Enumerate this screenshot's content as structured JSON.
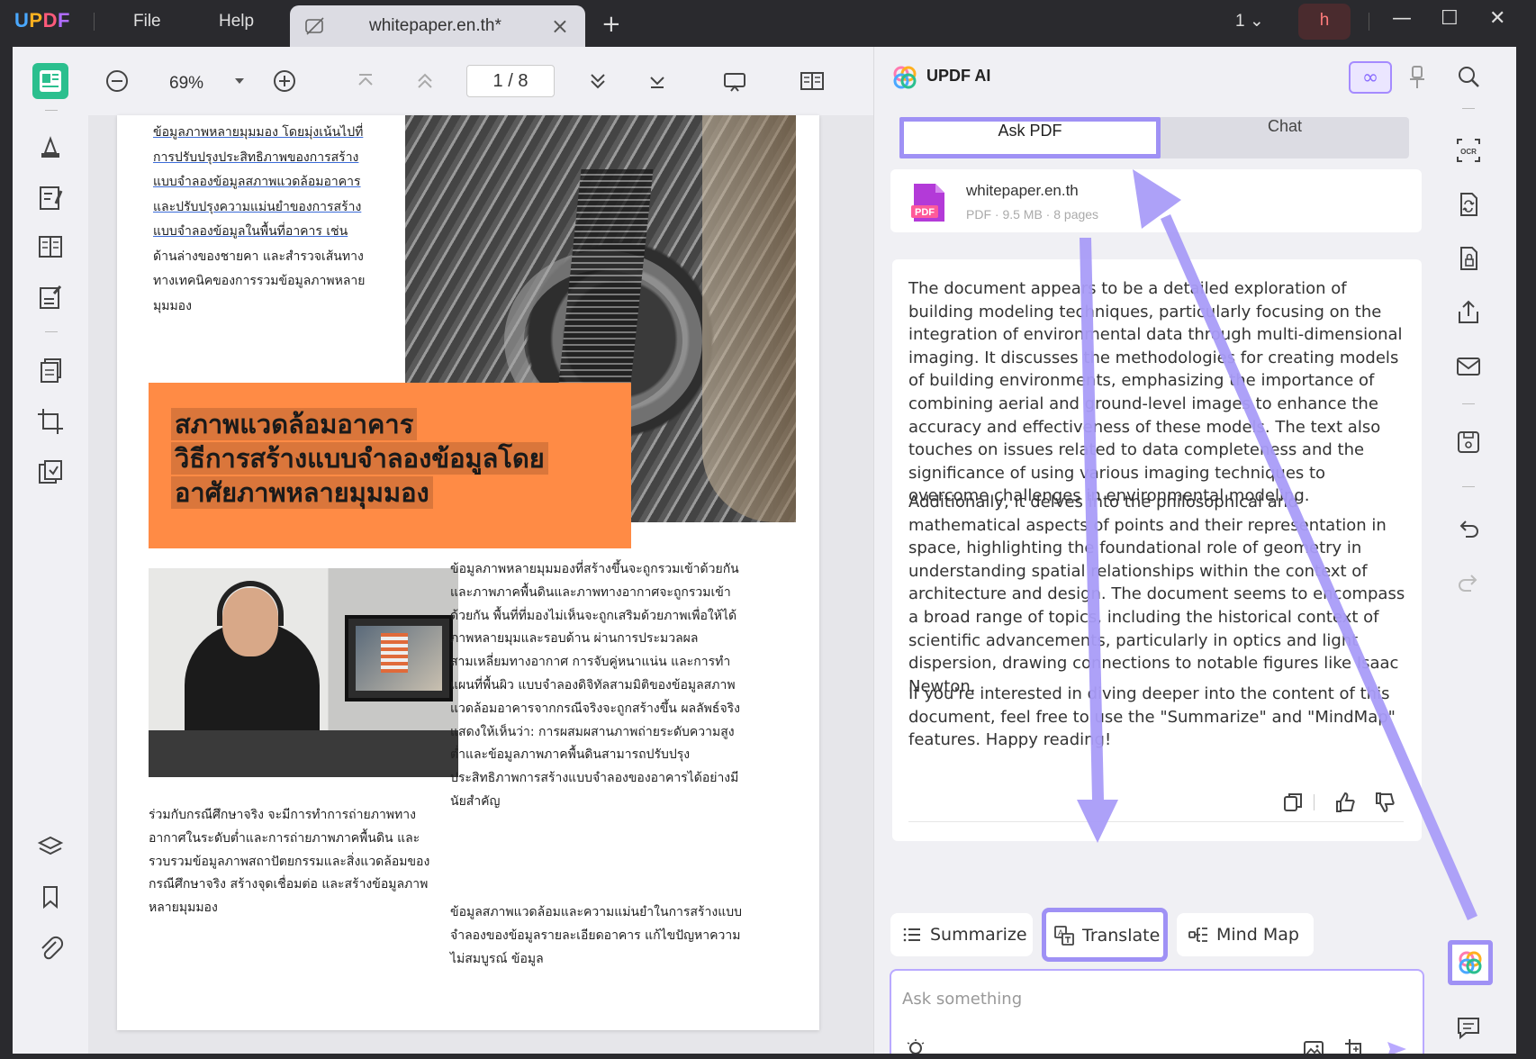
{
  "titlebar": {
    "logo": {
      "u": "U",
      "p": "P",
      "d": "D",
      "f": "F"
    },
    "menu_file": "File",
    "menu_help": "Help",
    "tab_title": "whitepaper.en.th*",
    "tab_close": "×",
    "new_tab": "+",
    "page_count": "1",
    "avatar_letter": "h",
    "minimize": "—",
    "maximize": "☐",
    "close": "✕"
  },
  "toolbar": {
    "zoom": "69%",
    "page_current": "1",
    "page_sep": "/",
    "page_total": "8"
  },
  "document": {
    "p1": [
      "ข้อมูลภาพหลายมุมมอง โดยมุ่งเน้นไปที่",
      "การปรับปรุงประสิทธิภาพของการสร้าง",
      "แบบจำลองข้อมูลสภาพแวดล้อมอาคาร",
      "และปรับปรุงความแม่นยำของการสร้าง",
      "แบบจำลองข้อมูลในพื้นที่อาคาร เช่น",
      "ด้านล่างของชายคา และสำรวจเส้นทาง",
      "ทางเทคนิคของการรวมข้อมูลภาพหลาย",
      "มุมมอง"
    ],
    "heading": [
      "สภาพแวดล้อมอาคาร",
      "วิธีการสร้างแบบจำลองข้อมูลโดย",
      "อาศัยภาพหลายมุมมอง"
    ],
    "p2": "ข้อมูลภาพหลายมุมมองที่สร้างขึ้นจะถูกรวมเข้าด้วยกันและภาพภาคพื้นดินและภาพทางอากาศจะถูกรวมเข้าด้วยกัน พื้นที่ที่มองไม่เห็นจะถูกเสริมด้วยภาพเพื่อให้ได้ภาพหลายมุมและรอบด้าน ผ่านการประมวลผลสามเหลี่ยมทางอากาศ การจับคู่หนาแน่น และการทำแผนที่พื้นผิว แบบจำลองดิจิทัลสามมิติของข้อมูลสภาพแวดล้อมอาคารจากกรณีจริงจะถูกสร้างขึ้น ผลลัพธ์จริงแสดงให้เห็นว่า: การผสมผสานภาพถ่ายระดับความสูงต่ำและข้อมูลภาพภาคพื้นดินสามารถปรับปรุงประสิทธิภาพการสร้างแบบจำลองของอาคารได้อย่างมีนัยสำคัญ",
    "p3": "ร่วมกับกรณีศึกษาจริง จะมีการทำการถ่ายภาพทางอากาศในระดับต่ำและการถ่ายภาพภาคพื้นดิน และรวบรวมข้อมูลภาพสถาปัตยกรรมและสิ่งแวดล้อมของกรณีศึกษาจริง สร้างจุดเชื่อมต่อ และสร้างข้อมูลภาพหลายมุมมอง",
    "p4": "ข้อมูลสภาพแวดล้อมและความแม่นยำในการสร้างแบบจำลองของข้อมูลรายละเอียดอาคาร แก้ไขปัญหาความไม่สมบูรณ์ ข้อมูล"
  },
  "ai": {
    "title": "UPDF AI",
    "infinity": "∞",
    "tab_ask": "Ask PDF",
    "tab_chat": "Chat",
    "file_name": "whitepaper.en.th",
    "file_meta": "PDF · 9.5 MB · 8 pages",
    "pdf_badge": "PDF",
    "answer_1": "The document appears to be a detailed exploration of building modeling techniques, particularly focusing on the integration of environmental data through multi-dimensional imaging. It discusses the methodologies for creating models of building environments, emphasizing the importance of combining aerial and ground-level images to enhance the accuracy and effectiveness of these models. The text also touches on issues related to data completeness and the significance of using various imaging techniques to overcome challenges in environmental modeling.",
    "answer_2": "Additionally, it delves into the philosophical and mathematical aspects of points and their representation in space, highlighting the foundational role of geometry in understanding spatial relationships within the context of architecture and design. The document seems to encompass a broad range of topics, including the historical context of scientific advancements, particularly in optics and light dispersion, drawing connections to notable figures like Isaac Newton.",
    "answer_3": "If you're interested in diving deeper into the content of this document, feel free to use the \"Summarize\" and \"MindMap\" features. Happy reading!",
    "chip_summarize": "Summarize",
    "chip_translate": "Translate",
    "chip_mindmap": "Mind Map",
    "input_placeholder": "Ask something"
  },
  "colors": {
    "accent_purple": "#9f91f5",
    "active_green": "#2bbf8e",
    "heading_orange": "#ff8b45"
  }
}
